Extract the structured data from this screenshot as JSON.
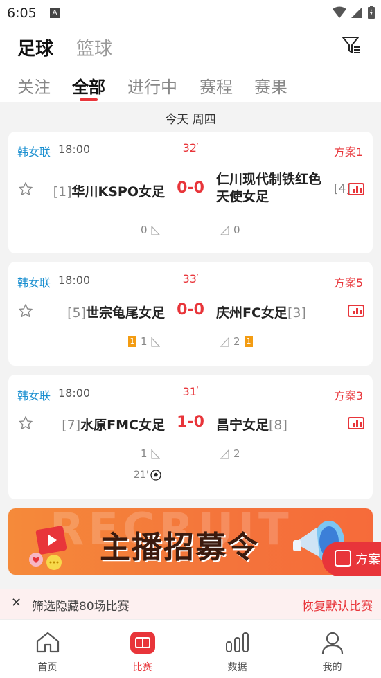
{
  "status_bar": {
    "time": "6:05"
  },
  "header": {
    "sport_tabs": [
      {
        "label": "足球",
        "active": true
      },
      {
        "label": "篮球",
        "active": false
      }
    ],
    "sub_tabs": [
      {
        "label": "关注"
      },
      {
        "label": "全部",
        "active": true
      },
      {
        "label": "进行中"
      },
      {
        "label": "赛程"
      },
      {
        "label": "赛果"
      }
    ]
  },
  "date_label": "今天 周四",
  "matches": [
    {
      "league": "韩女联",
      "time": "18:00",
      "minute": "32",
      "plan": "方案1",
      "home_rank": "[1]",
      "home": "华川KSPO女足",
      "score": "0-0",
      "away": "仁川现代制铁红色天使女足",
      "away_rank": "[4]",
      "home_corners": "0",
      "away_corners": "0"
    },
    {
      "league": "韩女联",
      "time": "18:00",
      "minute": "33",
      "plan": "方案5",
      "home_rank": "[5]",
      "home": "世宗龟尾女足",
      "score": "0-0",
      "away": "庆州FC女足",
      "away_rank": "[3]",
      "home_yellow": "1",
      "home_corners": "1",
      "away_corners": "2",
      "away_yellow": "1"
    },
    {
      "league": "韩女联",
      "time": "18:00",
      "minute": "31",
      "plan": "方案3",
      "home_rank": "[7]",
      "home": "水原FMC女足",
      "score": "1-0",
      "away": "昌宁女足",
      "away_rank": "[8]",
      "home_corners": "1",
      "away_corners": "2",
      "goal_event": "21'"
    }
  ],
  "banner": {
    "title": "主播招募令",
    "bg_word": "RECRUIT"
  },
  "floating_button": {
    "label": "方案"
  },
  "notice": {
    "text": "筛选隐藏80场比赛",
    "action": "恢复默认比赛"
  },
  "bottom_nav": [
    {
      "label": "首页"
    },
    {
      "label": "比赛",
      "active": true
    },
    {
      "label": "数据"
    },
    {
      "label": "我的"
    }
  ],
  "colors": {
    "accent": "#e8353a",
    "league": "#1a8fd0",
    "yellow_card": "#f39c12"
  }
}
